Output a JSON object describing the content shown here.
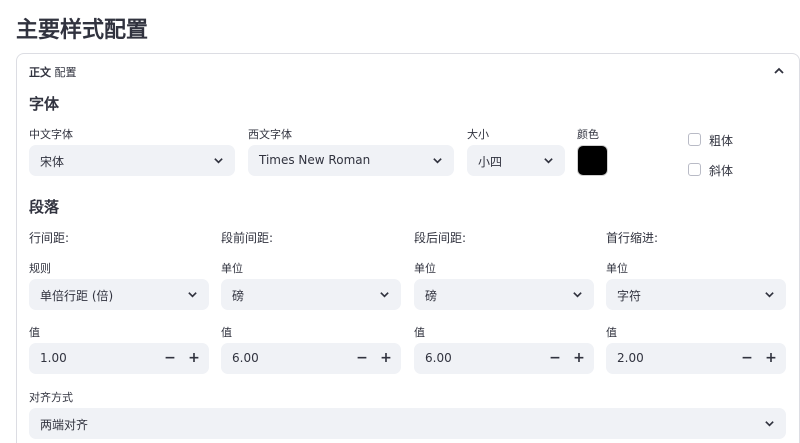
{
  "page": {
    "title": "主要样式配置"
  },
  "expander": {
    "title_bold": "正文",
    "title_rest": "配置"
  },
  "font": {
    "heading": "字体",
    "chinese": {
      "label": "中文字体",
      "value": "宋体"
    },
    "western": {
      "label": "西文字体",
      "value": "Times New Roman"
    },
    "size": {
      "label": "大小",
      "value": "小四"
    },
    "color": {
      "label": "颜色",
      "value": "#000000"
    },
    "bold": {
      "label": "粗体",
      "checked": false
    },
    "italic": {
      "label": "斜体",
      "checked": false
    }
  },
  "paragraph": {
    "heading": "段落",
    "columns": [
      {
        "title": "行间距:",
        "select_label": "规则",
        "select_value": "单倍行距 (倍)",
        "num_label": "值",
        "num_value": "1.00"
      },
      {
        "title": "段前间距:",
        "select_label": "单位",
        "select_value": "磅",
        "num_label": "值",
        "num_value": "6.00"
      },
      {
        "title": "段后间距:",
        "select_label": "单位",
        "select_value": "磅",
        "num_label": "值",
        "num_value": "6.00"
      },
      {
        "title": "首行缩进:",
        "select_label": "单位",
        "select_value": "字符",
        "num_label": "值",
        "num_value": "2.00"
      }
    ],
    "alignment": {
      "label": "对齐方式",
      "value": "两端对齐"
    },
    "stepper": {
      "minus": "−",
      "plus": "+"
    }
  }
}
